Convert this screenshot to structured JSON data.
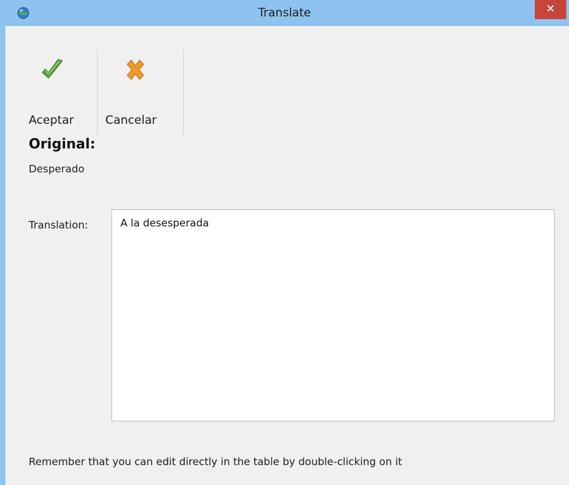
{
  "window": {
    "title": "Translate",
    "close_label": "✕"
  },
  "toolbar": {
    "accept_label": "Aceptar",
    "cancel_label": "Cancelar"
  },
  "original": {
    "heading": "Original:",
    "text": "Desperado"
  },
  "translation": {
    "label": "Translation:",
    "value": "A la desesperada"
  },
  "hint": "Remember that you can edit directly in the table by double-clicking on it",
  "colors": {
    "titlebar": "#8ec2ef",
    "close_button": "#c7453b",
    "client_background": "#f0f0f0",
    "accept_icon": "#5aa83a",
    "cancel_icon": "#f19a2a"
  },
  "icons": {
    "app": "globe-icon",
    "accept": "checkmark-icon",
    "cancel": "cross-icon"
  }
}
